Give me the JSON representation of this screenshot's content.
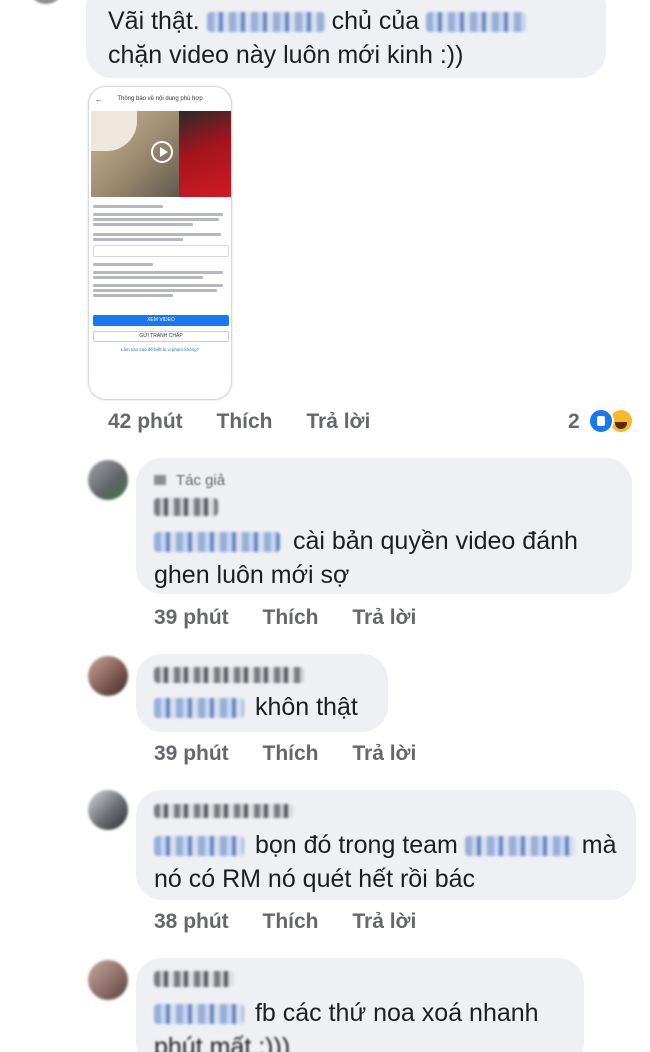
{
  "comments": [
    {
      "message_line1": "Vãi thật.",
      "message_mid": "chủ của",
      "message_line2": "chặn video này luôn mới kinh :))",
      "time": "42 phút",
      "like_label": "Thích",
      "reply_label": "Trả lời",
      "reaction_count": "2",
      "reactions": [
        "like-icon",
        "haha-icon"
      ],
      "attachment": {
        "screen_title": "Thông báo về nội dung phù hợp",
        "primary_button": "XEM VIDEO",
        "secondary_button": "GỬI TRANH CHẤP",
        "link_text": "Làm sao sao để biết bị vi phạm không?"
      }
    },
    {
      "author_badge": "Tác giả",
      "message_line1": "cài bản quyền video đánh",
      "message_line2": "ghen luôn mới sợ",
      "time": "39 phút",
      "like_label": "Thích",
      "reply_label": "Trả lời"
    },
    {
      "message_line1": "khôn thật",
      "time": "39 phút",
      "like_label": "Thích",
      "reply_label": "Trả lời"
    },
    {
      "message_line1": "bọn đó trong team",
      "message_mid": "mà",
      "message_line2": "nó có RM nó quét hết rồi bác",
      "time": "38 phút",
      "like_label": "Thích",
      "reply_label": "Trả lời"
    },
    {
      "message_line1": "fb các thứ noa xoá nhanh",
      "message_line2": "phút mất :)))"
    }
  ],
  "colors": {
    "bubble": "#eef0f3",
    "meta_text": "#65676b",
    "like_blue": "#1877f2",
    "haha_yellow": "#f7b928"
  }
}
